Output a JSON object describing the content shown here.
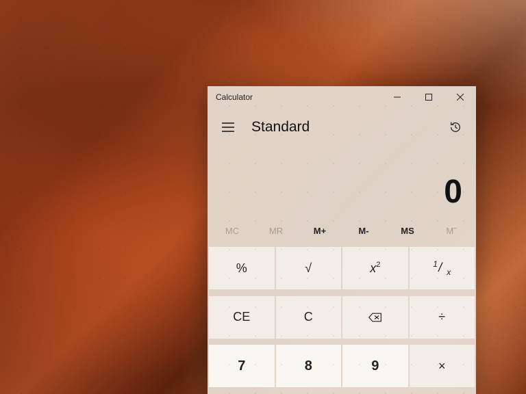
{
  "window": {
    "title": "Calculator"
  },
  "header": {
    "mode": "Standard"
  },
  "display": {
    "value": "0"
  },
  "memory": {
    "mc": "MC",
    "mr": "MR",
    "mplus": "M+",
    "mminus": "M-",
    "ms": "MS",
    "mlist": "Mˇ"
  },
  "keys": {
    "percent": "%",
    "sqrt": "√",
    "square_base": "x",
    "square_exp": "2",
    "recip_num": "1",
    "recip_slash": "/",
    "recip_den": "x",
    "ce": "CE",
    "c": "C",
    "divide": "÷",
    "multiply": "×",
    "d7": "7",
    "d8": "8",
    "d9": "9"
  }
}
